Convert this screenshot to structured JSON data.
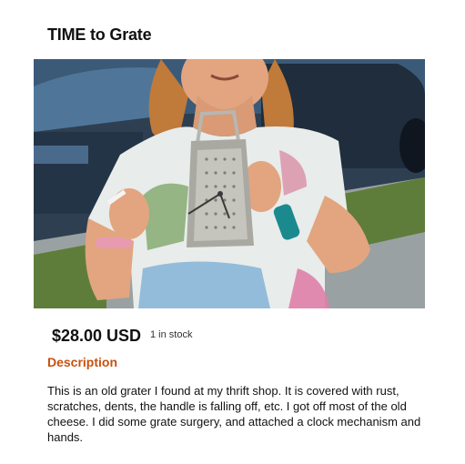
{
  "product": {
    "title": "TIME to Grate",
    "price": "$28.00 USD",
    "stock": "1 in stock"
  },
  "description": {
    "heading": "Description",
    "body": "This is an old grater I found at my thrift shop. It is covered with rust, scratches, dents, the handle is falling off, etc. I got off most of the old cheese. I did some grate surgery, and attached a clock mechanism and hands."
  },
  "colors": {
    "accent": "#c8500f",
    "text": "#111111"
  },
  "image": {
    "icon": "product-photo"
  }
}
